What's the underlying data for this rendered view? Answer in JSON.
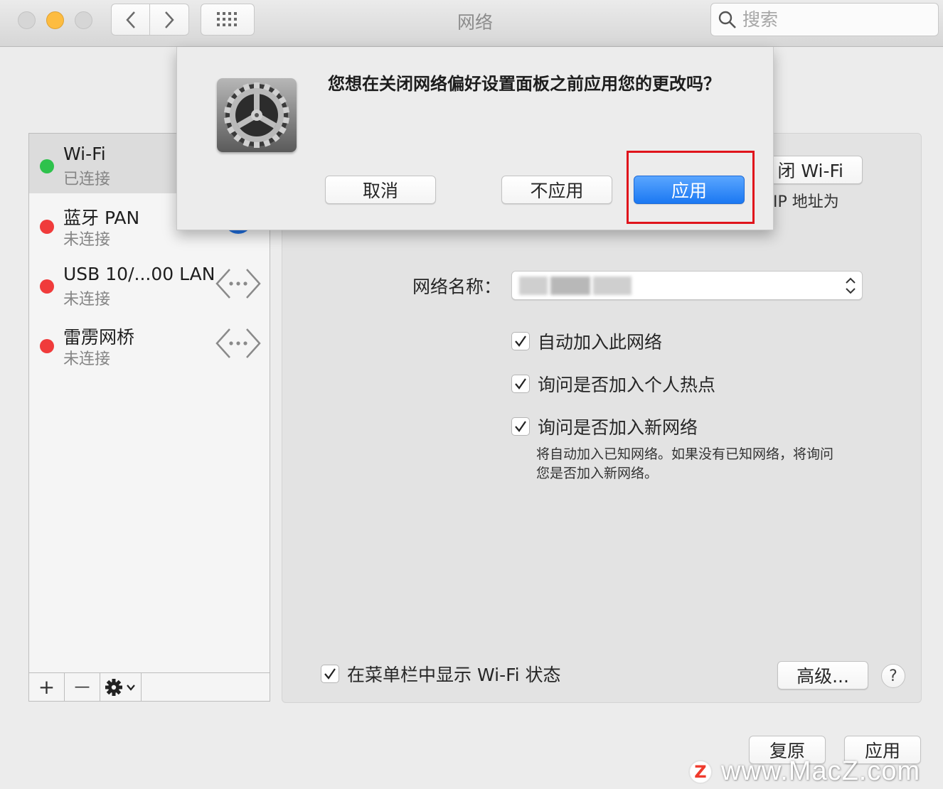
{
  "window": {
    "title": "网络",
    "search_placeholder": "搜索"
  },
  "sidebar": {
    "services": [
      {
        "name": "Wi-Fi",
        "status": "已连接",
        "status_color": "#2ec24c",
        "selected": true
      },
      {
        "name": "蓝牙 PAN",
        "status": "未连接",
        "status_color": "#f03b3b",
        "icon": "bluetooth-icon"
      },
      {
        "name": "USB 10/...00 LAN",
        "status": "未连接",
        "status_color": "#f03b3b",
        "icon": "ethernet-arrows-icon"
      },
      {
        "name": "雷雳网桥",
        "status": "未连接",
        "status_color": "#f03b3b",
        "icon": "ethernet-arrows-icon"
      }
    ],
    "toolbar": {
      "add": "+",
      "remove": "—"
    }
  },
  "main": {
    "turn_off_wifi_button": "闭 Wi-Fi",
    "ip_text": "IP 地址为",
    "network_name_label": "网络名称：",
    "checkboxes": [
      {
        "label": "自动加入此网络",
        "checked": true
      },
      {
        "label": "询问是否加入个人热点",
        "checked": true
      },
      {
        "label": "询问是否加入新网络",
        "checked": true
      }
    ],
    "note_line1": "将自动加入已知网络。如果没有已知网络，将询问",
    "note_line2": "您是否加入新网络。",
    "show_in_menubar": {
      "label": "在菜单栏中显示 Wi-Fi 状态",
      "checked": true
    },
    "advanced_button": "高级...",
    "help_button": "?"
  },
  "footer": {
    "revert_button": "复原",
    "apply_button": "应用"
  },
  "dialog": {
    "message": "您想在关闭网络偏好设置面板之前应用您的更改吗？",
    "cancel_button": "取消",
    "dont_apply_button": "不应用",
    "apply_button": "应用",
    "icon": "system-preferences-gear-icon",
    "primary_color": "#1b78f2",
    "highlight_color": "#e0141c"
  },
  "watermark": {
    "logo_letter": "Z",
    "text": "www.MacZ.com"
  }
}
